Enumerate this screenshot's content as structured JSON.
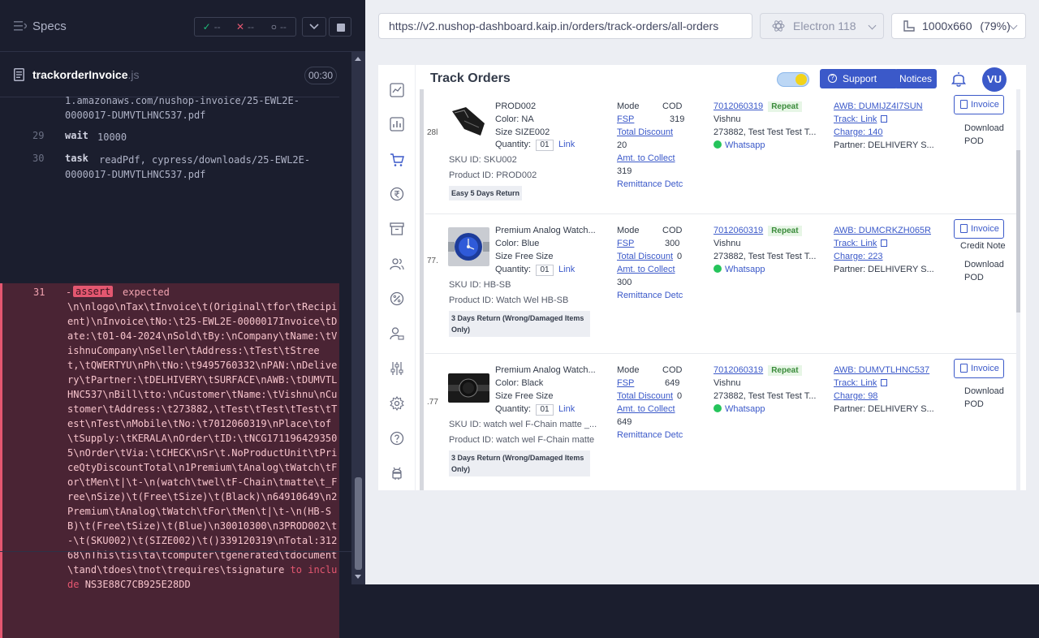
{
  "runner": {
    "specs_label": "Specs",
    "stats": {
      "passed": "--",
      "failed": "--",
      "pending": "--"
    },
    "spec_file": {
      "name": "trackorderInvoice",
      "ext": ".js"
    },
    "timer": "00:30",
    "log": {
      "prev_message_1": "1.amazonaws.com/nushop-invoice/25-EWL2E-",
      "prev_message_2": "0000017-DUMVTLHNC537.pdf",
      "cmd29": {
        "num": "29",
        "name": "wait",
        "message": "10000"
      },
      "cmd30": {
        "num": "30",
        "name": "task",
        "message_1": "readPdf, cypress/downloads/25-EWL2E-",
        "message_2": "0000017-DUMVTLHNC537.pdf"
      },
      "cmd31": {
        "num": "31",
        "dash": "-",
        "badge": "assert",
        "expected": "expected",
        "text": "\\n\\nlogo\\nTax\\tInvoice\\t(Original\\tfor\\tRecipient)\\nInvoice\\tNo:\\t25-EWL2E-0000017Invoice\\tDate:\\t01-04-2024\\nSold\\tBy:\\nCompany\\tName:\\tVishnuCompany\\nSeller\\tAddress:\\tTest\\tStreet,\\tQWERTYU\\nPh\\tNo:\\t9495760332\\nPAN:\\nDelivery\\tPartner:\\tDELHIVERY\\tSURFACE\\nAWB:\\tDUMVTLHNC537\\nBill\\tto:\\nCustomer\\tName:\\tVishnu\\nCustomer\\tAddress:\\t273882,\\tTest\\tTest\\tTest\\tTest\\nTest\\nMobile\\tNo:\\t7012060319\\nPlace\\tof\\tSupply:\\tKERALA\\nOrder\\tID:\\tNCG1711964293505\\nOrder\\tVia:\\tCHECK\\nSr\\t.NoProductUnit\\tPriceQtyDiscountTotal\\n1Premium\\tAnalog\\tWatch\\tFor\\tMen\\t|\\t-\\n(watch\\twel\\tF-Chain\\tmatte\\t_Free\\nSize)\\t(Free\\tSize)\\t(Black)\\n64910649\\n2Premium\\tAnalog\\tWatch\\tFor\\tMen\\t|\\t-\\n(HB-SB)\\t(Free\\tSize)\\t(Blue)\\n30010300\\n3PROD002\\t-\\t(SKU002)\\t(SIZE002)\\t()339120319\\nTotal:31268\\nThis\\tis\\ta\\tcomputer\\tgenerated\\tdocument\\tand\\tdoes\\tnot\\trequires\\tsignature",
        "to_include": "to include",
        "value": "NS3E88C7CB925E28DD"
      }
    }
  },
  "browser": {
    "url": "https://v2.nushop-dashboard.kaip.in/orders/track-orders/all-orders",
    "browser_name": "Electron 118",
    "viewport": "1000x660",
    "zoom": "(79%)"
  },
  "app": {
    "title": "Track Orders",
    "support_label": "Support",
    "notices_label": "Notices",
    "avatar_initials": "VU",
    "nav_icons": [
      "chart-line-icon",
      "bar-chart-icon",
      "cart-icon",
      "rupee-icon",
      "archive-icon",
      "users-icon",
      "percent-icon",
      "user-settings-icon",
      "sliders-icon",
      "gear-icon",
      "help-icon",
      "android-icon"
    ],
    "orders": [
      {
        "id_fragment": "28l",
        "title": "PROD002",
        "color": "Color: NA",
        "size_label": "Size",
        "size": "SIZE002",
        "qty_label": "Quantity:",
        "qty": "01",
        "link": "Link",
        "sku": "SKU ID: SKU002",
        "product_id": "Product ID: PROD002",
        "badge": "Easy 5 Days Return",
        "mode_label": "Mode",
        "mode": "COD",
        "fsp_label": "FSP",
        "fsp": "319",
        "discount_label": "Total Discount",
        "discount": "20",
        "collect_label": "Amt. to Collect",
        "collect": "319",
        "remit": "Remittance Detc",
        "phone": "7012060319",
        "repeat": "Repeat",
        "name": "Vishnu",
        "address": "273882, Test Test Test T...",
        "whatsapp": "Whatsapp",
        "awb": "AWB: DUMIJZ4I7SUN",
        "track": "Track: Link",
        "charge": "Charge: 140",
        "partner": "Partner: DELHIVERY S...",
        "invoice": "Invoice",
        "credit_note": "",
        "download": "Download",
        "pod": "POD"
      },
      {
        "id_fragment": "77.",
        "title": "Premium Analog Watch...",
        "color": "Color: Blue",
        "size_label": "Size",
        "size": "Free Size",
        "qty_label": "Quantity:",
        "qty": "01",
        "link": "Link",
        "sku": "SKU ID: HB-SB",
        "product_id": "Product ID: Watch Wel HB-SB",
        "badge": "3 Days Return (Wrong/Damaged Items Only)",
        "mode_label": "Mode",
        "mode": "COD",
        "fsp_label": "FSP",
        "fsp": "300",
        "discount_label": "Total Discount",
        "discount": "0",
        "collect_label": "Amt. to Collect",
        "collect": "300",
        "remit": "Remittance Detc",
        "phone": "7012060319",
        "repeat": "Repeat",
        "name": "Vishnu",
        "address": "273882, Test Test Test T...",
        "whatsapp": "Whatsapp",
        "awb": "AWB: DUMCRKZH065R",
        "track": "Track: Link",
        "charge": "Charge: 223",
        "partner": "Partner: DELHIVERY S...",
        "invoice": "Invoice",
        "credit_note": "Credit Note",
        "download": "Download",
        "pod": "POD"
      },
      {
        "id_fragment": ".77",
        "title": "Premium Analog Watch...",
        "color": "Color: Black",
        "size_label": "Size",
        "size": "Free Size",
        "qty_label": "Quantity:",
        "qty": "01",
        "link": "Link",
        "sku": "SKU ID: watch wel F-Chain matte _...",
        "product_id": "Product ID: watch wel F-Chain matte",
        "badge": "3 Days Return (Wrong/Damaged Items Only)",
        "mode_label": "Mode",
        "mode": "COD",
        "fsp_label": "FSP",
        "fsp": "649",
        "discount_label": "Total Discount",
        "discount": "0",
        "collect_label": "Amt. to Collect",
        "collect": "649",
        "remit": "Remittance Detc",
        "phone": "7012060319",
        "repeat": "Repeat",
        "name": "Vishnu",
        "address": "273882, Test Test Test T...",
        "whatsapp": "Whatsapp",
        "awb": "AWB: DUMVTLHNC537",
        "track": "Track: Link",
        "charge": "Charge: 98",
        "partner": "Partner: DELHIVERY S...",
        "invoice": "Invoice",
        "credit_note": "",
        "download": "Download",
        "pod": "POD"
      }
    ]
  }
}
